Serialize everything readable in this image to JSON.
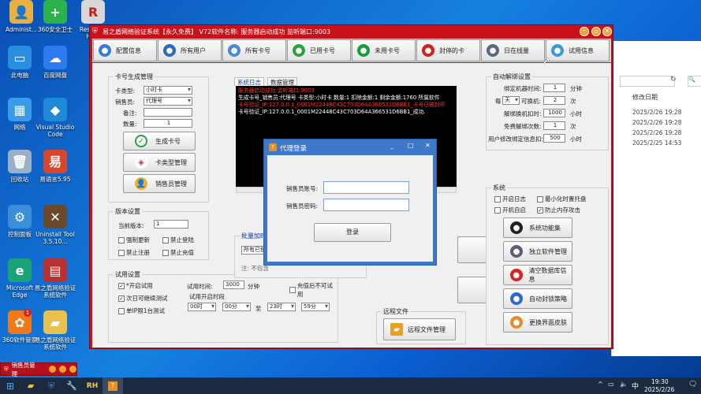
{
  "desktop": {
    "icons": [
      {
        "label": "Administ...",
        "color": "#e8b040"
      },
      {
        "label": "360安全卫士",
        "color": "#2bb24c"
      },
      {
        "label": "Resource Ha...",
        "color": "#d8d8d8"
      },
      {
        "label": "此电脑",
        "color": "#2a8ee0"
      },
      {
        "label": "百度网盘",
        "color": "#2c7bf0"
      },
      {
        "label": "网络",
        "color": "#3a9be8"
      },
      {
        "label": "Visual Studio Code",
        "color": "#1f8ad8"
      },
      {
        "label": "回收站",
        "color": "#9ab0c8"
      },
      {
        "label": "易语言5.95",
        "color": "#d8462e"
      },
      {
        "label": "控制面板",
        "color": "#3a8fd8"
      },
      {
        "label": "Uninstall Tool 3.5.10...",
        "color": "#6a4a2a"
      },
      {
        "label": "Microsoft Edge",
        "color": "#1aa37a"
      },
      {
        "label": "易之盾网络验证系统软件",
        "color": "#b83030"
      },
      {
        "label": "360软件管家",
        "color": "#f07a1a"
      },
      {
        "label": "易之盾网络验证系统软件",
        "color": "#e8c050"
      }
    ],
    "badge_360": "1"
  },
  "explorer": {
    "col_header": "修改日期",
    "dates": [
      "2025/2/26 19:28",
      "2025/2/26 19:28",
      "2025/2/26 19:28",
      "2025/2/25 14:53"
    ]
  },
  "window": {
    "title": "易之盾网络验证系统【永久免费】 V72软件名称: 服务器启动成功 监听端口:9003",
    "toolbar": [
      {
        "label": "配置信息",
        "icon": "gear-icon",
        "color": "#3a7ad0"
      },
      {
        "label": "所有用户",
        "icon": "users-icon",
        "color": "#2a6ab8"
      },
      {
        "label": "所有卡号",
        "icon": "cards-icon",
        "color": "#4a8ad0"
      },
      {
        "label": "已用卡号",
        "icon": "check-user-icon",
        "color": "#2aa040"
      },
      {
        "label": "未用卡号",
        "icon": "add-user-icon",
        "color": "#1a9a3a"
      },
      {
        "label": "封停的卡",
        "icon": "block-user-icon",
        "color": "#d02020"
      },
      {
        "label": "日在线量",
        "icon": "search-icon",
        "color": "#5a6a7a"
      },
      {
        "label": "试用信息",
        "icon": "chat-icon",
        "color": "#3a9ad8"
      }
    ],
    "card_gen": {
      "title": "卡号生成管理",
      "card_type_label": "卡类型:",
      "card_type_value": "小时卡",
      "seller_label": "销售员:",
      "seller_value": "代理号",
      "note_label": "备注:",
      "note_value": "",
      "qty_label": "数量:",
      "qty_value": "1",
      "btn_generate": "生成卡号",
      "btn_types": "卡类型管理",
      "btn_sellers": "销售员管理"
    },
    "version": {
      "title": "版本设置",
      "current_label": "当前版本:",
      "current_value": "1",
      "force_update": "强制更新",
      "force_update_checked": false,
      "disable_login": "禁止登陆",
      "disable_login_checked": false,
      "disable_register": "禁止注册",
      "disable_register_checked": false,
      "disable_recharge": "禁止充值",
      "disable_recharge_checked": false
    },
    "trial": {
      "title": "试用设置",
      "enable": "*开启试用",
      "enable_checked": true,
      "next_day": "次日可继续测试",
      "next_day_checked": true,
      "single_ip": "单IP限1台测试",
      "single_ip_checked": false,
      "time_label": "试用时间:",
      "time_value": "3000",
      "time_unit": "分钟",
      "after_recharge": "充值后不可试用",
      "after_recharge_checked": false,
      "period_label": "试用开启时段",
      "start_hour": "00时",
      "start_min": "00分",
      "to": "至",
      "end_hour": "23时",
      "end_min": "59分"
    },
    "log": {
      "tab_system": "系统日志",
      "tab_data": "数据管理",
      "lines": [
        {
          "text": "服务器启动成功 监听端口:9003",
          "color": "#ff3030"
        },
        {
          "text": "生成卡号_销售员:代理号 卡类型:小时卡 数量:1 扣除金额:1 剩余金额:1760 所属软件",
          "color": "#ffffff"
        },
        {
          "text": "卡号验证_IP:127.0.0.1_0001M22448C43C703D64A366531D6BB1_卡号已被封停",
          "color": "#ff3030"
        },
        {
          "text": "卡号验证_IP:127.0.0.1_0001M22448C43C703D64A366531D6BB1_成功.",
          "color": "#ffffff"
        }
      ]
    },
    "batch": {
      "title": "批量加时",
      "select_value": "所有已使",
      "note": "注: 不包含"
    },
    "remote": {
      "title": "远程文件",
      "btn": "远程文件管理"
    },
    "auto_unbind": {
      "title": "自动解绑设置",
      "rows": [
        {
          "label": "绑定机器时间:",
          "value": "1",
          "unit": "分钟"
        },
        {
          "label": "可换机:",
          "prefix_label": "每",
          "prefix_value": "天",
          "value": "2",
          "unit": "次"
        },
        {
          "label": "解绑换机扣时:",
          "value": "1000",
          "unit": "小时"
        },
        {
          "label": "免费解绑次数:",
          "value": "1",
          "unit": "次"
        },
        {
          "label": "用户修改绑定信息扣:",
          "value": "500",
          "unit": "小时"
        }
      ]
    },
    "system": {
      "title": "系统",
      "open_log": "开启日志",
      "open_log_checked": false,
      "minimize_tray": "最小化时置托盘",
      "minimize_tray_checked": false,
      "autostart": "开机自启",
      "autostart_checked": false,
      "anti_attack": "防止内存攻击",
      "anti_attack_checked": true,
      "buttons": [
        {
          "label": "系统功能集",
          "icon": "gears-icon",
          "color": "#222"
        },
        {
          "label": "独立软件管理",
          "icon": "server-icon",
          "color": "#5a6070"
        },
        {
          "label": "清空数据库信息",
          "icon": "clear-icon",
          "color": "#e02020"
        },
        {
          "label": "自动封锁策略",
          "icon": "shield-icon",
          "color": "#2a6ad0"
        },
        {
          "label": "更换界面皮肤",
          "icon": "palette-icon",
          "color": "#e0902a"
        }
      ]
    }
  },
  "dialog": {
    "title": "代理登录",
    "account_label": "销售员账号:",
    "password_label": "销售员密码:",
    "account_value": "",
    "password_value": "",
    "login_btn": "登录"
  },
  "taskbar_app": {
    "label": "销售员管理"
  },
  "tray": {
    "ime": "中",
    "time": "19:30",
    "date": "2025/2/26"
  }
}
